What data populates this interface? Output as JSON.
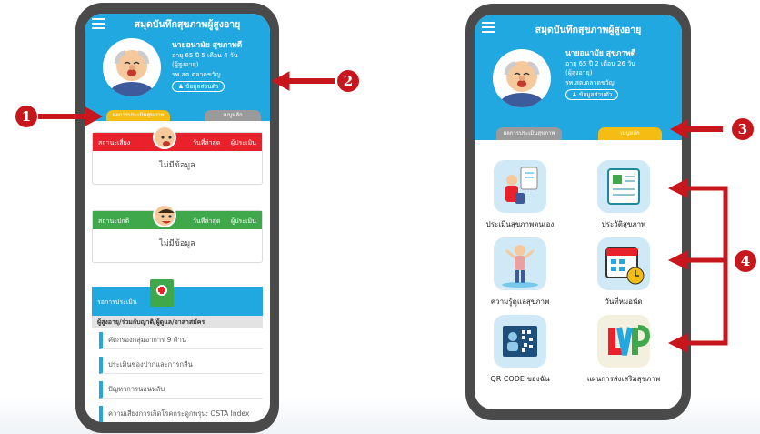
{
  "phone_left": {
    "header": {
      "title": "สมุดบันทึกสุขภาพผู้สูงอายุ"
    },
    "profile": {
      "name": "นายอนามัย สุขภาพดี",
      "age": "อายุ 65 ปี 5 เดือน 4 วัน",
      "group": "(ผู้สูงอายุ)",
      "hospital": "รพ.สต.ตลาดขวัญ",
      "info_button": "ข้อมูลส่วนตัว"
    },
    "tabs": {
      "active": "ผลการประเมินสุขภาพ",
      "inactive": "เมนูหลัก"
    },
    "risk_card": {
      "status": "สถานะเสี่ยง",
      "latest": "วันที่ล่าสุด",
      "assessor": "ผู้ประเมิน",
      "body": "ไม่มีข้อมูล",
      "color": "#e8212a"
    },
    "normal_card": {
      "status": "สถานะปกติ",
      "latest": "วันที่ล่าสุด",
      "assessor": "ผู้ประเมิน",
      "body": "ไม่มีข้อมูล",
      "color": "#3ea84a"
    },
    "assessment": {
      "header": "รอการประเมิน",
      "subheader": "ผู้สูงอายุ/ร่วมกับญาติ/ผู้ดูแล/อาสาสมัคร",
      "items": [
        "คัดกรองกลุ่มอาการ 9 ด้าน",
        "ประเมินช่องปากและการกลืน",
        "ปัญหาการนอนหลับ",
        "ความเสี่ยงการเกิดโรคกระดูกพรุน: OSTA Index"
      ]
    }
  },
  "phone_right": {
    "header": {
      "title": "สมุดบันทึกสุขภาพผู้สูงอายุ"
    },
    "profile": {
      "name": "นายอนามัย สุขภาพดี",
      "age": "อายุ 65 ปี 2 เดือน 26 วัน",
      "group": "(ผู้สูงอายุ)",
      "hospital": "รพ.สต.ตลาดขวัญ",
      "info_button": "ข้อมูลส่วนตัว"
    },
    "tabs": {
      "inactive": "ผลการประเมินสุขภาพ",
      "active": "เมนูหลัก"
    },
    "menu": [
      {
        "label": "ประเมินสุขภาพตนเอง",
        "icon": "self-assessment-icon"
      },
      {
        "label": "ประวัติสุขภาพ",
        "icon": "health-history-icon"
      },
      {
        "label": "ความรู้ดูแลสุขภาพ",
        "icon": "health-knowledge-icon"
      },
      {
        "label": "วันที่หมอนัด",
        "icon": "appointment-calendar-icon"
      },
      {
        "label": "QR CODE ของฉัน",
        "icon": "qr-code-icon"
      },
      {
        "label": "แผนการส่งเสริมสุขภาพ",
        "icon": "lvp-plan-icon"
      }
    ]
  },
  "callouts": [
    "1",
    "2",
    "3",
    "4"
  ],
  "colors": {
    "primary": "#21a8e0",
    "tab_active": "#f5bd14",
    "callout": "#c8161d"
  }
}
